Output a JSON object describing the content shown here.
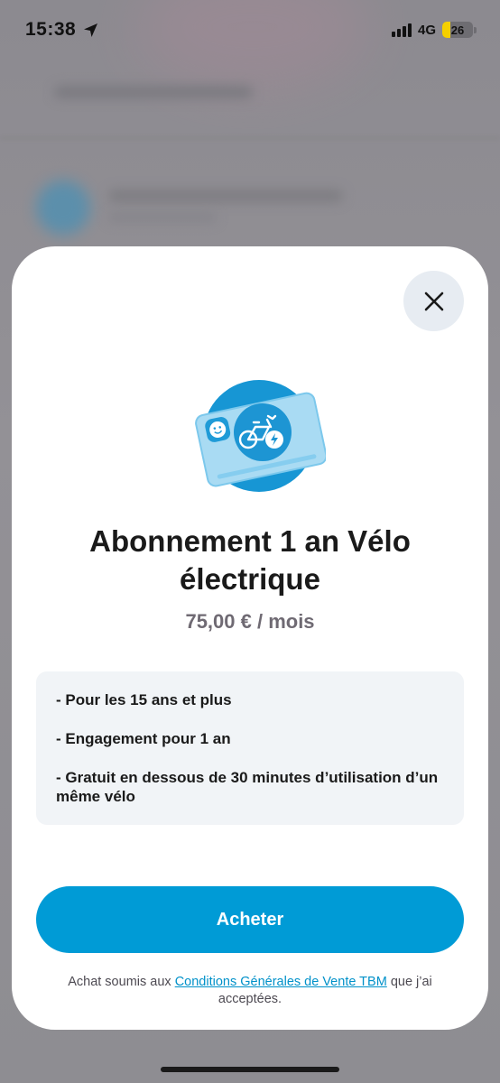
{
  "status_bar": {
    "time": "15:38",
    "network": "4G",
    "battery_level": "26",
    "battery_fraction": 0.26,
    "location_icon": "location-arrow-icon",
    "signal_icon": "cellular-signal-icon"
  },
  "sheet": {
    "close_icon": "close-icon",
    "hero_icon": "electric-bike-card-icon",
    "title": "Abonnement 1 an Vélo électrique",
    "price": "75,00 € / mois",
    "features": [
      "- Pour les 15 ans et plus",
      "- Engagement pour 1 an",
      "- Gratuit en dessous de 30 minutes d’utilisation d’un même vélo"
    ],
    "buy_label": "Acheter",
    "legal_prefix": "Achat soumis aux ",
    "legal_link": "Conditions Générales de Vente TBM",
    "legal_suffix": " que j’ai acceptées."
  },
  "colors": {
    "accent": "#009bd6",
    "info_background": "#f1f4f7",
    "price_text": "#6f6a73",
    "battery": "#f5d000"
  }
}
